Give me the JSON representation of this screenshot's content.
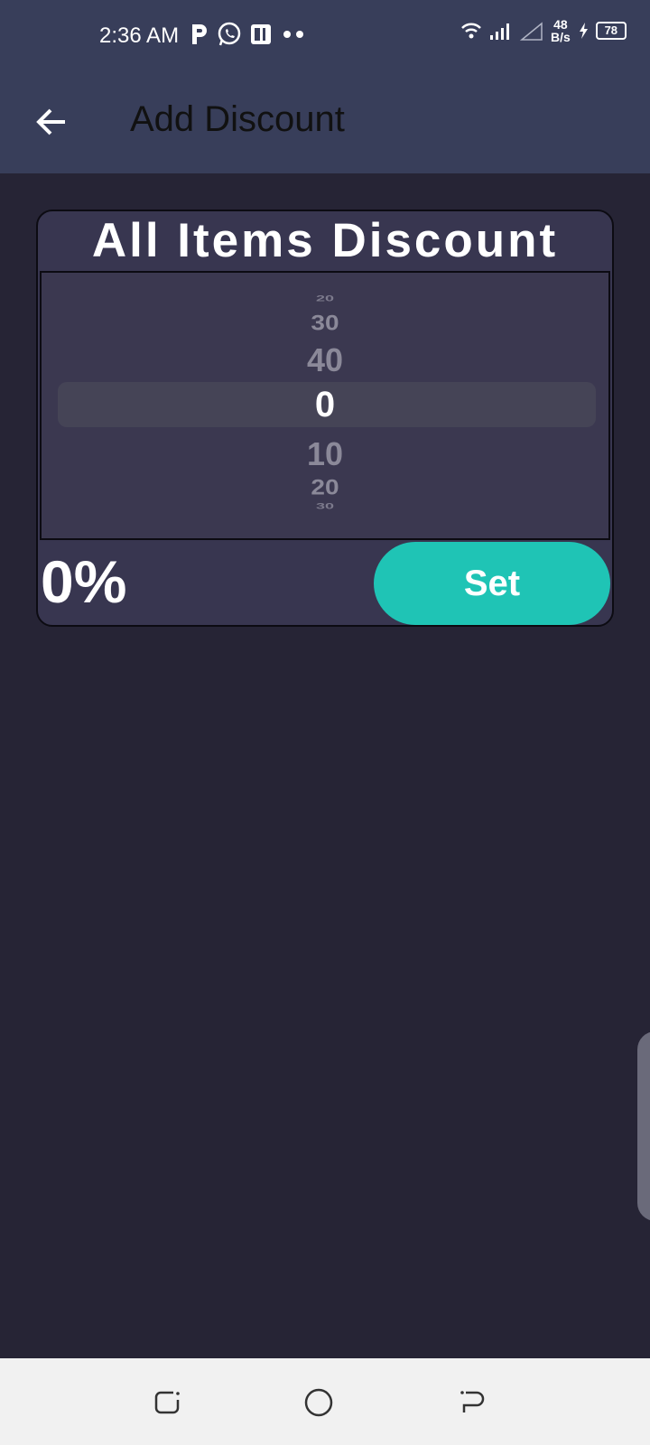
{
  "status_bar": {
    "time": "2:36 AM",
    "net_speed_value": "48",
    "net_speed_unit": "B/s",
    "battery": "78",
    "icons_left": [
      "p-app-icon",
      "whatsapp-icon",
      "pl-app-icon",
      "more-dots-icon"
    ],
    "icons_right": [
      "wifi-icon",
      "signal-icon",
      "signal-empty-icon",
      "charging-icon",
      "battery-icon"
    ]
  },
  "app_bar": {
    "title": "Add Discount",
    "back_icon": "arrow-left-icon"
  },
  "discount_card": {
    "title": "All Items Discount",
    "picker": {
      "items_above": [
        "20",
        "30",
        "40"
      ],
      "selected": "0",
      "items_below": [
        "10",
        "20",
        "30"
      ]
    },
    "current_value": "0%",
    "set_label": "Set"
  },
  "colors": {
    "app_bar": "#383e5a",
    "background": "#262435",
    "card": "#383650",
    "accent": "#1fc4b5"
  },
  "nav_bar": {
    "icons": [
      "recents-icon",
      "home-icon",
      "back-icon"
    ]
  }
}
